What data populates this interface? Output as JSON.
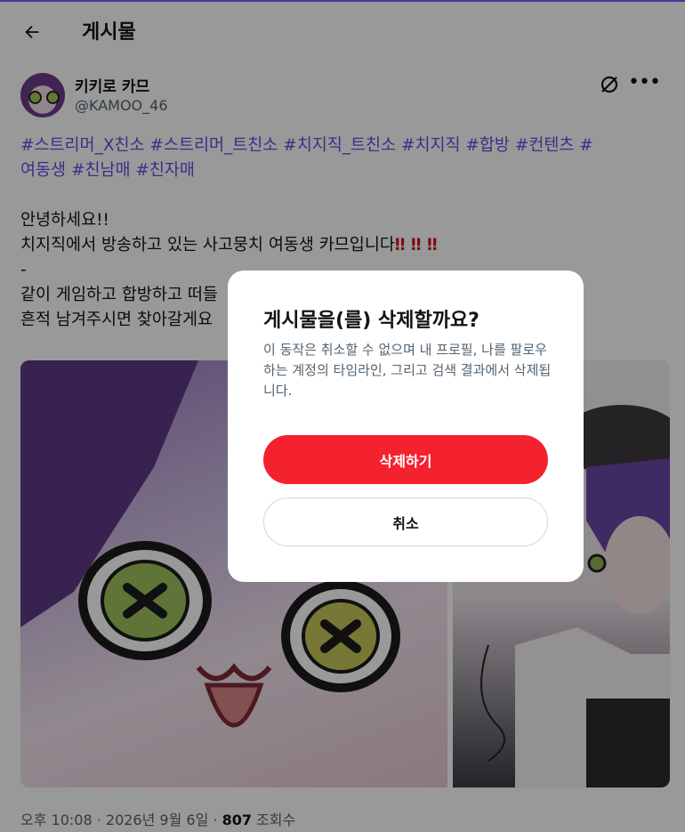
{
  "header": {
    "title": "게시물"
  },
  "post": {
    "author_name": "키키로 카므",
    "author_handle": "@KAMOO_46",
    "hashtag_line1": "#스트리머_X친소 #스트리머_트친소 #치지직_트친소 #치지직 #합방 #컨텐츠 #",
    "hashtag_line2": "여동생 #친남매 #친자매",
    "greeting": "안녕하세요!!",
    "intro": "치지직에서 방송하고 있는 사고뭉치 여동생 카므입니다",
    "bangs": "‼ ‼ ‼",
    "dash": "-",
    "line_partial1": "같이 게임하고 합방하고 떠들",
    "line_partial2": "흔적 남겨주시면 찾아갈게요",
    "meta_time": "오후 10:08 · 2026년 9월 6일 · ",
    "meta_views_count": "807",
    "meta_views_label": " 조회수"
  },
  "dialog": {
    "title": "게시물을(를) 삭제할까요?",
    "description": "이 동작은 취소할 수 없으며 내 프로필, 나를 팔로우하는 계정의 타임라인, 그리고 검색 결과에서 삭제됩니다.",
    "delete_label": "삭제하기",
    "cancel_label": "취소"
  },
  "icons": {
    "back": "back-arrow-icon",
    "grok": "grok-icon",
    "more": "more-icon"
  },
  "colors": {
    "accent": "#7856ff",
    "hashtag": "#6a4be0",
    "delete": "#f4212e"
  }
}
